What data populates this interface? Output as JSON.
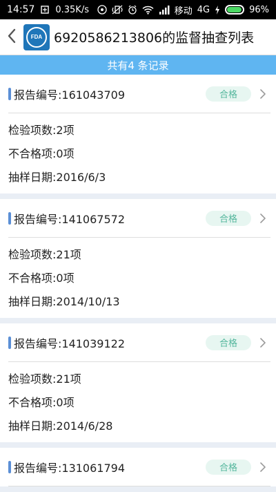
{
  "status_bar": {
    "time": "14:57",
    "net_speed": "0.35K/s",
    "carrier": "移动",
    "network": "4G",
    "battery_level": "96%",
    "battery_fraction": 0.96,
    "icons": [
      "signal-icon",
      "wifi-icon",
      "alarm-icon",
      "vibrate-icon",
      "hd-icon",
      "charging-icon",
      "battery-icon"
    ]
  },
  "header": {
    "title": "6920586213806的监督抽查列表",
    "logo_text": "FDA"
  },
  "banner": {
    "text": "共有4 条记录"
  },
  "colors": {
    "banner": "#5fb5f1",
    "accent": "#5b8fd6",
    "badge_bg": "#e7f6f1",
    "badge_text": "#53b69c",
    "logo": "#1f76b9"
  },
  "records": [
    {
      "report": "报告编号:161043709",
      "status": "合格",
      "items": "检验项数:2项",
      "failed": "不合格项:0项",
      "date": "抽样日期:2016/6/3"
    },
    {
      "report": "报告编号:141067572",
      "status": "合格",
      "items": "检验项数:21项",
      "failed": "不合格项:0项",
      "date": "抽样日期:2014/10/13"
    },
    {
      "report": "报告编号:141039122",
      "status": "合格",
      "items": "检验项数:21项",
      "failed": "不合格项:0项",
      "date": "抽样日期:2014/6/28"
    },
    {
      "report": "报告编号:131061794",
      "status": "合格"
    }
  ]
}
